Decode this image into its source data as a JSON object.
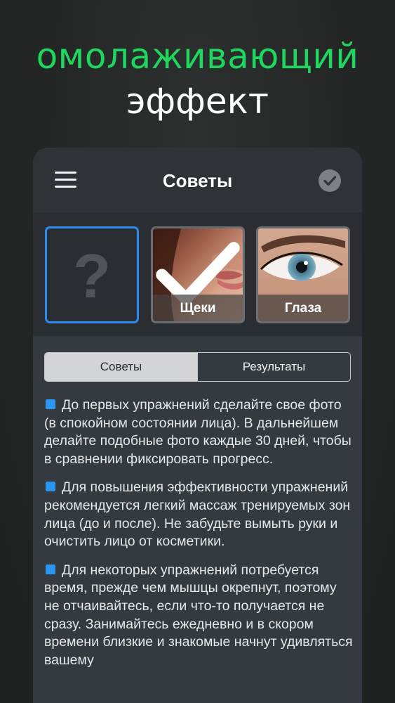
{
  "promo": {
    "line1": "омолаживающий",
    "line2": "эффект"
  },
  "header": {
    "title": "Советы",
    "left_icon": "menu-icon",
    "right_icon": "check-circle-icon"
  },
  "thumbnails": [
    {
      "label": "?",
      "type": "empty",
      "selected": false
    },
    {
      "label": "Щеки",
      "type": "cheeks",
      "selected": true
    },
    {
      "label": "Глаза",
      "type": "eyes",
      "selected": false
    }
  ],
  "segment": {
    "active": "Советы",
    "inactive": "Результаты"
  },
  "tips": [
    "До первых упражнений сделайте свое фото (в спокойном состоянии лица). В дальнейшем делайте подобные фото каждые 30 дней, чтобы в сравнении фиксировать прогресс.",
    "Для повышения эффективности упражнений рекомендуется легкий массаж тренируемых зон лица (до и после). Не забудьте вымыть руки и очистить лицо от косметики.",
    "Для некоторых упражнений потребуется время, прежде чем мышцы окрепнут, поэтому не отчаивайтесь, если что-то получается не сразу. Занимайтесь ежедневно и в скором времени близкие и знакомые начнут удивляться вашему"
  ],
  "colors": {
    "accent_green": "#1fd65f",
    "accent_blue": "#2a8cf0",
    "background": "#232625",
    "panel": "#353a40"
  }
}
